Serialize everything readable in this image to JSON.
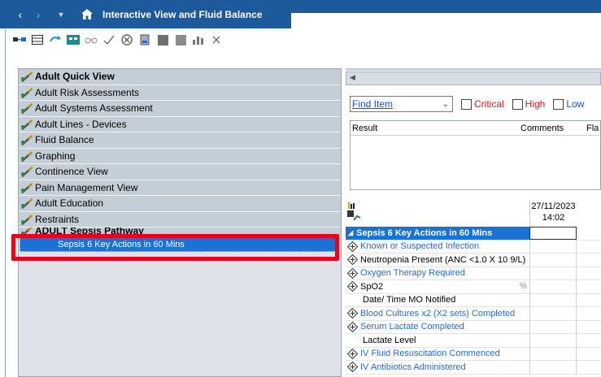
{
  "window": {
    "title": "Interactive View and Fluid Balance",
    "nav_back": "‹",
    "nav_forward": "›",
    "nav_dropdown": "▼",
    "accent": "#1c5a9c"
  },
  "toolbar": {
    "icons": [
      "link-icon",
      "table-icon",
      "refresh-icon",
      "grid-icon",
      "glasses-icon",
      "checkmark-icon",
      "cancel-circle-icon",
      "document-icon",
      "square-icon",
      "square-grey-icon",
      "chart-icon",
      "close-icon"
    ]
  },
  "navigator": {
    "items": [
      {
        "label": "Adult Quick View",
        "bold": true
      },
      {
        "label": "Adult Risk Assessments"
      },
      {
        "label": "Adult Systems Assessment"
      },
      {
        "label": "Adult Lines - Devices"
      },
      {
        "label": "Fluid Balance"
      },
      {
        "label": "Graphing"
      },
      {
        "label": "Continence View"
      },
      {
        "label": "Pain Management View"
      },
      {
        "label": "Adult Education"
      },
      {
        "label": "Restraints"
      },
      {
        "label": "ADULT Sepsis Pathway",
        "bold": true
      }
    ],
    "selected_sub_item": "Sepsis 6 Key Actions in 60 Mins",
    "highlight_color": "#e8001c"
  },
  "filter": {
    "find_item": "Find Item",
    "critical": "Critical",
    "high": "High",
    "low": "Low"
  },
  "results": {
    "col_result": "Result",
    "col_comments": "Comments",
    "col_flag": "Fla"
  },
  "grid": {
    "date": "27/11/2023",
    "time": "14:02",
    "section": "Sepsis 6 Key Actions in 60 Mins",
    "rows": [
      {
        "label": "Known or Suspected Infection",
        "type": "link"
      },
      {
        "label": "Neutropenia Present (ANC <1.0 X 10 9/L)",
        "type": "black"
      },
      {
        "label": "Oxygen Therapy Required",
        "type": "link"
      },
      {
        "label": "SpO2",
        "type": "black",
        "unit": "%"
      },
      {
        "label": "Date/ Time MO Notified",
        "type": "plain"
      },
      {
        "label": "Blood Cultures x2 (X2 sets) Completed",
        "type": "link"
      },
      {
        "label": "Serum Lactate Completed",
        "type": "link"
      },
      {
        "label": "Lactate Level",
        "type": "plain"
      },
      {
        "label": "IV Fluid Resuscitation Commenced",
        "type": "link"
      },
      {
        "label": "IV Antibiotics Administered",
        "type": "link"
      }
    ]
  }
}
